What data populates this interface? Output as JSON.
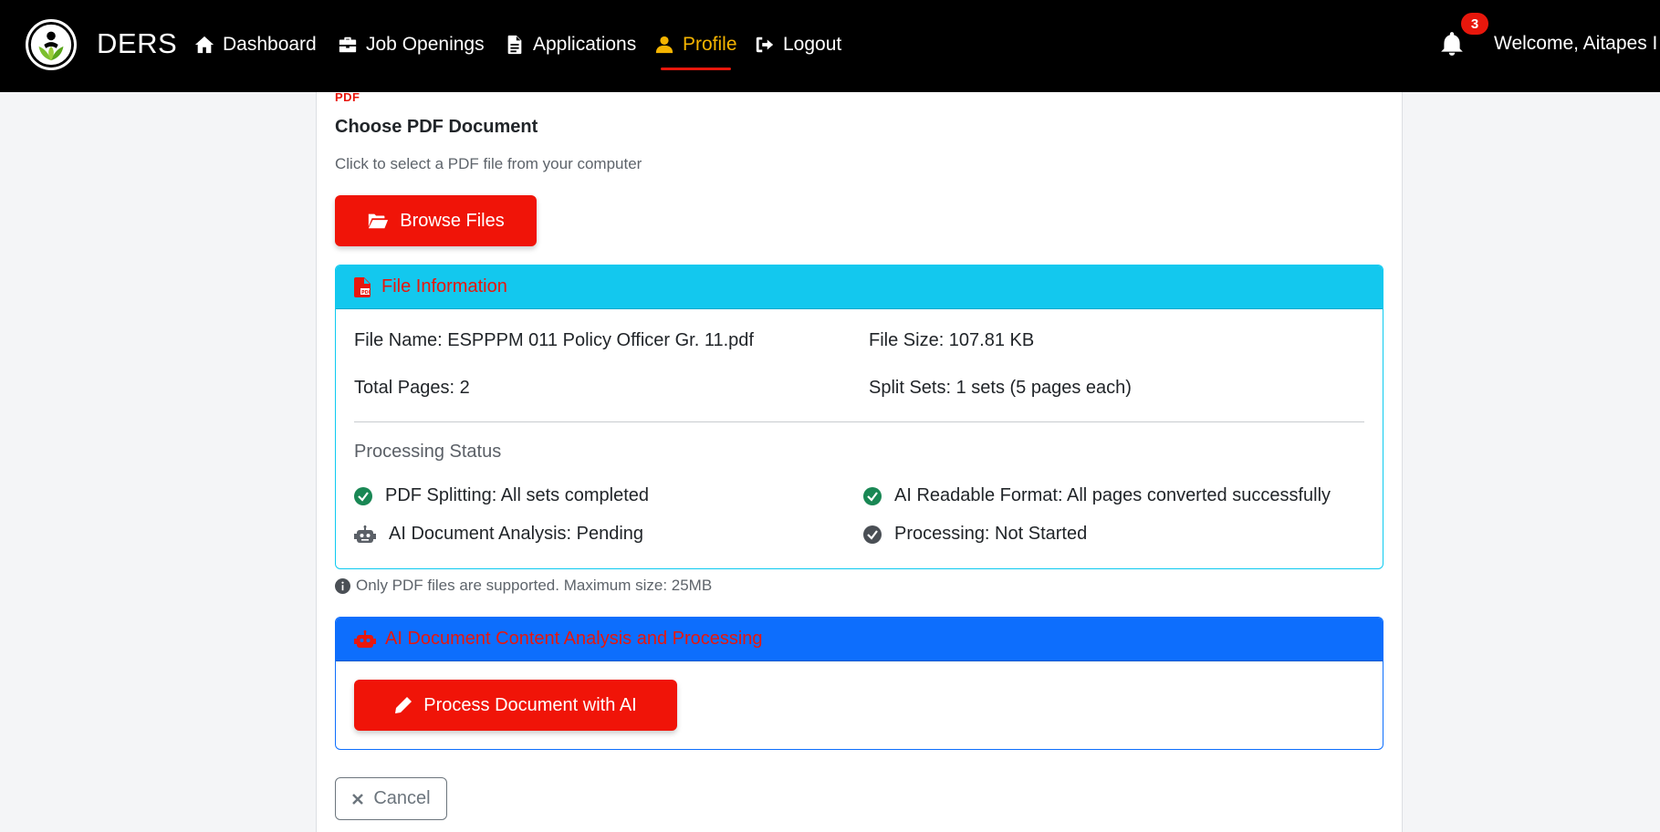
{
  "nav": {
    "brand": "DERS",
    "items": [
      {
        "label": "Dashboard",
        "icon": "home-icon"
      },
      {
        "label": "Job Openings",
        "icon": "briefcase-icon"
      },
      {
        "label": "Applications",
        "icon": "document-icon"
      },
      {
        "label": "Profile",
        "icon": "user-icon",
        "active": true
      },
      {
        "label": "Logout",
        "icon": "logout-icon"
      }
    ],
    "notification_count": "3",
    "welcome": "Welcome, Aitapes I"
  },
  "upload": {
    "pdf_tag": "PDF",
    "title": "Choose PDF Document",
    "subtitle": "Click to select a PDF file from your computer",
    "browse_label": "Browse Files"
  },
  "file_info": {
    "header": "File Information",
    "file_name": "File Name: ESPPPM 011 Policy Officer Gr. 11.pdf",
    "file_size": "File Size: 107.81 KB",
    "total_pages": "Total Pages: 2",
    "split_sets": "Split Sets: 1 sets (5 pages each)",
    "processing_title": "Processing Status",
    "statuses": [
      {
        "label": "PDF Splitting: All sets completed",
        "icon": "check-circle-icon"
      },
      {
        "label": "AI Readable Format: All pages converted successfully",
        "icon": "check-circle-icon"
      },
      {
        "label": "AI Document Analysis: Pending",
        "icon": "robot-icon"
      },
      {
        "label": "Processing: Not Started",
        "icon": "check-circle-icon"
      }
    ]
  },
  "note": "Only PDF files are supported. Maximum size: 25MB",
  "ai": {
    "header": "AI Document Content Analysis and Processing",
    "process_label": "Process Document with AI"
  },
  "cancel_label": "Cancel",
  "colors": {
    "navbar": "#000000",
    "accent_red": "#f01408",
    "active_nav": "#f5b400",
    "info_header": "#13c8ee",
    "ai_header": "#0d6efd",
    "success": "#198754"
  }
}
